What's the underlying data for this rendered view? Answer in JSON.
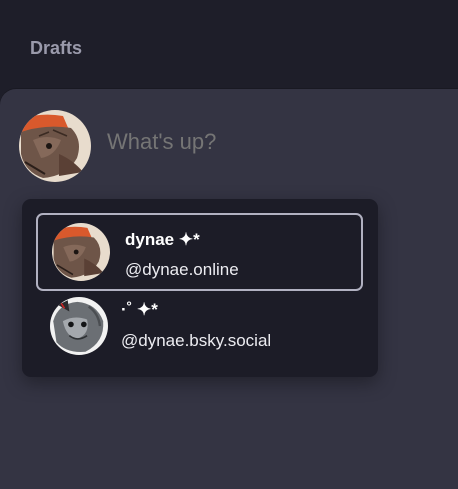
{
  "header": {
    "drafts_label": "Drafts"
  },
  "composer": {
    "placeholder": "What's up?"
  },
  "accounts": [
    {
      "display_name": "dynae ✦*",
      "handle": "@dynae.online",
      "selected": true
    },
    {
      "display_name": "·˚ ✦*",
      "handle": "@dynae.bsky.social",
      "selected": false
    }
  ],
  "colors": {
    "background": "#1e1e29",
    "composer": "#343443",
    "switcher": "#1c1c27",
    "selected_border": "#b1b1c1"
  },
  "icons": [
    "avatar-rat-orange-bandana",
    "avatar-gray-grayscale"
  ]
}
